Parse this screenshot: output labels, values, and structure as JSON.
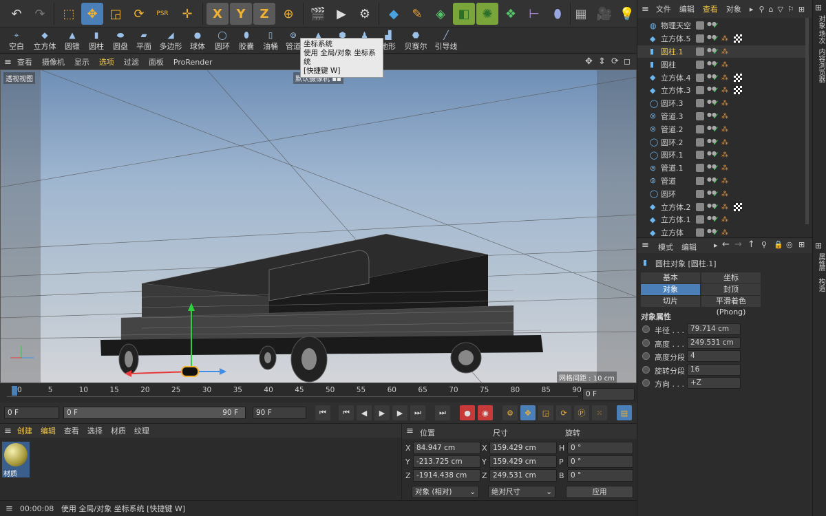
{
  "toolbar": {
    "tools": [
      "undo-icon",
      "redo-icon",
      "rect-select-icon",
      "move-icon",
      "scale-icon",
      "rotate-icon",
      "psr-icon",
      "coordinate-icon",
      "x-axis-icon",
      "y-axis-icon",
      "z-axis-icon",
      "world-coord-icon",
      "render-view-icon",
      "render-picture-icon",
      "render-settings-icon",
      "cube-icon",
      "pen-icon",
      "subdivision-icon",
      "generator-icon",
      "mograph-icon",
      "cloner-icon",
      "deformer-icon",
      "effector-icon",
      "floor-icon",
      "camera-icon",
      "light-icon"
    ],
    "psr_label": "PSR",
    "axis_labels": [
      "X",
      "Y",
      "Z"
    ]
  },
  "objbar": {
    "items": [
      {
        "label": "空白",
        "icon": "null-icon"
      },
      {
        "label": "立方体",
        "icon": "cube-icon"
      },
      {
        "label": "圆锥",
        "icon": "cone-icon"
      },
      {
        "label": "圆柱",
        "icon": "cylinder-icon"
      },
      {
        "label": "圆盘",
        "icon": "disc-icon"
      },
      {
        "label": "平面",
        "icon": "plane-icon"
      },
      {
        "label": "多边形",
        "icon": "polygon-icon"
      },
      {
        "label": "球体",
        "icon": "sphere-icon"
      },
      {
        "label": "圆环",
        "icon": "torus-icon"
      },
      {
        "label": "胶囊",
        "icon": "capsule-icon"
      },
      {
        "label": "油桶",
        "icon": "oil-tank-icon"
      },
      {
        "label": "管道",
        "icon": "tube-icon"
      },
      {
        "label": "",
        "icon": "pyramid-icon"
      },
      {
        "label": "",
        "icon": "platonic-icon"
      },
      {
        "label": "",
        "icon": "figure-icon"
      },
      {
        "label": "地形",
        "icon": "landscape-icon"
      },
      {
        "label": "贝赛尔",
        "icon": "bezier-icon"
      },
      {
        "label": "引导线",
        "icon": "guide-icon"
      }
    ]
  },
  "tooltip": {
    "title": "坐标系统",
    "line1": "使用 全局/对象 坐标系统",
    "line2": "[快捷键 W]"
  },
  "viewport": {
    "menu": [
      "查看",
      "摄像机",
      "显示",
      "选项",
      "过滤",
      "面板",
      "ProRender"
    ],
    "active_menu": "选项",
    "view_label": "透视视图",
    "camera_label": "默认摄像机",
    "grid_label": "网格间距 : 10 cm"
  },
  "timeline": {
    "ticks": [
      "0",
      "5",
      "10",
      "15",
      "20",
      "25",
      "30",
      "35",
      "40",
      "45",
      "50",
      "55",
      "60",
      "65",
      "70",
      "75",
      "80",
      "85",
      "90"
    ],
    "current_frame": "0 F"
  },
  "transport": {
    "start": "0 F",
    "range_start": "0 F",
    "range_end": "90 F",
    "end": "90 F"
  },
  "materials": {
    "menu": [
      "创建",
      "编辑",
      "查看",
      "选择",
      "材质",
      "纹理"
    ],
    "items": [
      {
        "label": "材质"
      }
    ]
  },
  "coords": {
    "headers": [
      "位置",
      "尺寸",
      "旋转"
    ],
    "rows": [
      {
        "axis": "X",
        "pos": "84.947 cm",
        "size_axis": "X",
        "size": "159.429 cm",
        "rot_axis": "H",
        "rot": "0 °"
      },
      {
        "axis": "Y",
        "pos": "-213.725 cm",
        "size_axis": "Y",
        "size": "159.429 cm",
        "rot_axis": "P",
        "rot": "0 °"
      },
      {
        "axis": "Z",
        "pos": "-1914.438 cm",
        "size_axis": "Z",
        "size": "249.531 cm",
        "rot_axis": "B",
        "rot": "0 °"
      }
    ],
    "mode": "对象 (相对)",
    "size_mode": "绝对尺寸",
    "apply": "应用"
  },
  "status": {
    "time": "00:00:08",
    "message": "使用 全局/对象 坐标系统 [快捷键 W]"
  },
  "objmgr": {
    "menu": [
      "文件",
      "编辑",
      "查看",
      "对象"
    ],
    "active_menu": "查看",
    "objects": [
      {
        "name": "物理天空",
        "icon": "sky-icon",
        "phong": false,
        "checker": false,
        "selected": false
      },
      {
        "name": "立方体.5",
        "icon": "cube-icon",
        "phong": true,
        "checker": true,
        "selected": false
      },
      {
        "name": "圆柱.1",
        "icon": "cylinder-icon",
        "phong": true,
        "checker": false,
        "selected": true
      },
      {
        "name": "圆柱",
        "icon": "cylinder-icon",
        "phong": true,
        "checker": false,
        "selected": false
      },
      {
        "name": "立方体.4",
        "icon": "cube-icon",
        "phong": true,
        "checker": true,
        "selected": false
      },
      {
        "name": "立方体.3",
        "icon": "cube-icon",
        "phong": true,
        "checker": true,
        "selected": false
      },
      {
        "name": "圆环.3",
        "icon": "torus-icon",
        "phong": true,
        "checker": false,
        "selected": false
      },
      {
        "name": "管道.3",
        "icon": "tube-icon",
        "phong": true,
        "checker": false,
        "selected": false
      },
      {
        "name": "管道.2",
        "icon": "tube-icon",
        "phong": true,
        "checker": false,
        "selected": false
      },
      {
        "name": "圆环.2",
        "icon": "torus-icon",
        "phong": true,
        "checker": false,
        "selected": false
      },
      {
        "name": "圆环.1",
        "icon": "torus-icon",
        "phong": true,
        "checker": false,
        "selected": false
      },
      {
        "name": "管道.1",
        "icon": "tube-icon",
        "phong": true,
        "checker": false,
        "selected": false
      },
      {
        "name": "管道",
        "icon": "tube-icon",
        "phong": true,
        "checker": false,
        "selected": false
      },
      {
        "name": "圆环",
        "icon": "torus-icon",
        "phong": true,
        "checker": false,
        "selected": false
      },
      {
        "name": "立方体.2",
        "icon": "cube-icon",
        "phong": true,
        "checker": true,
        "selected": false
      },
      {
        "name": "立方体.1",
        "icon": "cube-icon",
        "phong": true,
        "checker": false,
        "selected": false
      },
      {
        "name": "立方体",
        "icon": "cube-icon",
        "phong": true,
        "checker": false,
        "selected": false
      }
    ]
  },
  "attrmgr": {
    "menu": [
      "模式",
      "编辑"
    ],
    "title": "圆柱对象 [圆柱.1]",
    "tabs": [
      [
        "基本",
        "坐标"
      ],
      [
        "对象",
        "封顶"
      ],
      [
        "切片",
        "平滑着色(Phong)"
      ]
    ],
    "active_tab": "对象",
    "section": "对象属性",
    "props": [
      {
        "label": "半径 . . .",
        "value": "79.714 cm"
      },
      {
        "label": "高度 . . .",
        "value": "249.531 cm"
      },
      {
        "label": "高度分段",
        "value": "4"
      },
      {
        "label": "旋转分段",
        "value": "16"
      },
      {
        "label": "方向 . . .",
        "value": "+Z"
      }
    ]
  },
  "sidetabs": {
    "top": [
      "对象",
      "场次",
      "内容浏览器"
    ],
    "bottom": [
      "属性",
      "层",
      "构造"
    ]
  },
  "colors": {
    "accent": "#4b7fb8",
    "check": "#3dc65a",
    "phong": "#e09640"
  }
}
